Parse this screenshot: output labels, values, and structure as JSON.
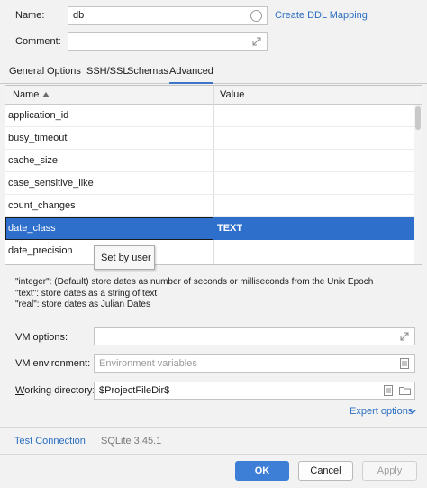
{
  "general": {
    "name_label": "Name:",
    "name_value": "db",
    "create_ddl_label": "Create DDL Mapping",
    "comment_label": "Comment:",
    "comment_value": ""
  },
  "tabs": [
    {
      "label": "General",
      "active": false
    },
    {
      "label": "Options",
      "active": false
    },
    {
      "label": "SSH/SSL",
      "active": false
    },
    {
      "label": "Schemas",
      "active": false
    },
    {
      "label": "Advanced",
      "active": true
    }
  ],
  "table": {
    "columns": [
      "Name",
      "Value"
    ],
    "sort_icon": "sort-ascending-icon",
    "rows": [
      {
        "name": "application_id",
        "value": ""
      },
      {
        "name": "busy_timeout",
        "value": ""
      },
      {
        "name": "cache_size",
        "value": ""
      },
      {
        "name": "case_sensitive_like",
        "value": ""
      },
      {
        "name": "count_changes",
        "value": ""
      },
      {
        "name": "date_class",
        "value": "TEXT",
        "selected": true
      },
      {
        "name": "date_precision",
        "value": ""
      }
    ],
    "tooltip": "Set by user"
  },
  "description": [
    "\"integer\": (Default) store dates as number of seconds or milliseconds from the Unix Epoch",
    "\"text\": store dates as a string of text",
    "\"real\": store dates as Julian Dates"
  ],
  "vm": {
    "options_label": "VM options:",
    "options_value": "",
    "environment_label": "VM environment:",
    "environment_placeholder": "Environment variables",
    "working_dir_label_prefix": "W",
    "working_dir_label_rest": "orking directory:",
    "working_dir_value": "$ProjectFileDir$"
  },
  "expert_options_label": "Expert options",
  "footer": {
    "test_connection_label": "Test Connection",
    "driver_version": "SQLite 3.45.1"
  },
  "buttons": {
    "ok": "OK",
    "cancel": "Cancel",
    "apply": "Apply"
  },
  "colors": {
    "accent": "#3d7ed6",
    "selection": "#2e6fcb",
    "link": "#2a6ec1"
  }
}
